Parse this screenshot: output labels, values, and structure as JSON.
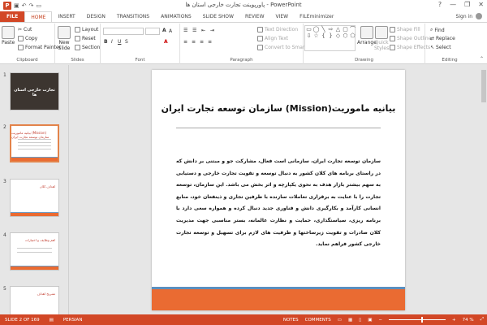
{
  "app": {
    "title": "پاورپوینت تجارت خارجی استان ها - PowerPoint",
    "icon_letter": "P"
  },
  "quick_access": [
    "save-icon",
    "undo-icon",
    "redo-icon",
    "start-icon"
  ],
  "window_controls": {
    "help": "?",
    "minimize": "—",
    "restore": "❐",
    "close": "✕"
  },
  "tabs": [
    {
      "id": "file",
      "label": "FILE"
    },
    {
      "id": "home",
      "label": "HOME"
    },
    {
      "id": "insert",
      "label": "INSERT"
    },
    {
      "id": "design",
      "label": "DESIGN"
    },
    {
      "id": "transitions",
      "label": "TRANSITIONS"
    },
    {
      "id": "animations",
      "label": "ANIMATIONS"
    },
    {
      "id": "slideshow",
      "label": "SLIDE SHOW"
    },
    {
      "id": "review",
      "label": "REVIEW"
    },
    {
      "id": "view",
      "label": "VIEW"
    },
    {
      "id": "fileminimizer",
      "label": "FILEminimizer"
    }
  ],
  "account": {
    "signin": "Sign in"
  },
  "ribbon": {
    "clipboard": {
      "label": "Clipboard",
      "paste": "Paste",
      "cut": "Cut",
      "copy": "Copy",
      "format_painter": "Format Painter"
    },
    "slides": {
      "label": "Slides",
      "new_slide": "New",
      "new_slide_2": "Slide",
      "layout": "Layout",
      "reset": "Reset",
      "section": "Section"
    },
    "font": {
      "label": "Font"
    },
    "paragraph": {
      "label": "Paragraph",
      "text_direction": "Text Direction",
      "align_text": "Align Text",
      "convert": "Convert to SmartArt"
    },
    "drawing": {
      "label": "Drawing",
      "arrange": "Arrange",
      "quick_styles": "Quick",
      "quick_styles_2": "Styles",
      "shape_fill": "Shape Fill",
      "shape_outline": "Shape Outline",
      "shape_effects": "Shape Effects"
    },
    "editing": {
      "label": "Editing",
      "find": "Find",
      "replace": "Replace",
      "select": "Select"
    }
  },
  "thumbnails": [
    {
      "number": "1",
      "title": "تجارت خارجی استان ها"
    },
    {
      "number": "2",
      "title": "بیانیه ماموریت (Mission) سازمان توسعه تجارت ایران"
    },
    {
      "number": "3",
      "title": "اهداف کلان"
    },
    {
      "number": "4",
      "title": "اهم وظایف و اختیارات"
    },
    {
      "number": "5",
      "title": "تشریح اهداف"
    }
  ],
  "slide": {
    "title": "بیانیه ماموریت(Mission) سازمان توسعه تجارت ایران",
    "body": "سازمان توسعه تجارت ایران، سازمانی است فعال، مشارکت جو و مبتنی بر دانش که در راستای برنامه های کلان کشور به دنبال توسعه و تقویت تجارت خارجی و دستیابی به سهم بیشتر بازار هدف به نحوی یکپارچه و اثر بخش می باشد. این سازمان، توسعه تجارت را با عنایت به برقراری تعاملات سازنده با طرفین تجاری و ذینفعان خود، منابع انسانی کارآمد و بکارگیری دانش و فناوری جدید دنبال کرده و همواره سعی دارد با برنامه ریزی، سیاستگذاری، حمایت و نظارت عالمانه، بستر مناسبی جهت مدیریت کلان صادرات و تقویت زیرساختها و ظرفیت های لازم برای تسهیل و توسعه تجارت خارجی کشور فراهم نماید."
  },
  "status": {
    "slide_count": "SLIDE 2 OF 169",
    "language": "PERSIAN",
    "notes": "NOTES",
    "comments": "COMMENTS",
    "zoom": "74 %"
  },
  "colors": {
    "accent": "#d24726",
    "slide_orange": "#ea6b32",
    "slide_blue": "#5b8fbf"
  }
}
